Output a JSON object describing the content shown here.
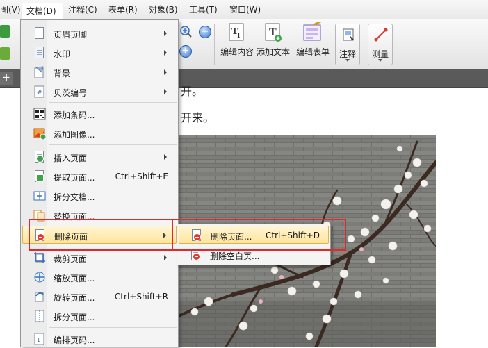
{
  "menubar": {
    "items": [
      {
        "label": "图(V)"
      },
      {
        "label": "文档(D)"
      },
      {
        "label": "注释(C)"
      },
      {
        "label": "表单(R)"
      },
      {
        "label": "对象(B)"
      },
      {
        "label": "工具(T)"
      },
      {
        "label": "窗口(W)"
      }
    ]
  },
  "toolbar": {
    "edit_content": "编辑内容",
    "add_text": "添加文本",
    "edit_form": "编辑表单",
    "annotate": "注释",
    "measure": "测量"
  },
  "tabstrip": {
    "plus": "+"
  },
  "document": {
    "line1": "开。",
    "line2": "开来。"
  },
  "document_menu": {
    "items": [
      {
        "label": "页眉页脚",
        "shortcut": ""
      },
      {
        "label": "水印",
        "shortcut": ""
      },
      {
        "label": "背景",
        "shortcut": ""
      },
      {
        "label": "贝茨编号",
        "shortcut": ""
      },
      {
        "label": "添加条码...",
        "shortcut": ""
      },
      {
        "label": "添加图像...",
        "shortcut": ""
      },
      {
        "label": "插入页面",
        "shortcut": ""
      },
      {
        "label": "提取页面...",
        "shortcut": "Ctrl+Shift+E"
      },
      {
        "label": "拆分文档...",
        "shortcut": ""
      },
      {
        "label": "替换页面...",
        "shortcut": ""
      },
      {
        "label": "删除页面",
        "shortcut": ""
      },
      {
        "label": "裁剪页面",
        "shortcut": ""
      },
      {
        "label": "缩放页面...",
        "shortcut": ""
      },
      {
        "label": "旋转页面...",
        "shortcut": "Ctrl+Shift+R"
      },
      {
        "label": "拆分页面...",
        "shortcut": ""
      },
      {
        "label": "编排页码...",
        "shortcut": ""
      }
    ]
  },
  "delete_submenu": {
    "items": [
      {
        "label": "删除页面...",
        "shortcut": "Ctrl+Shift+D"
      },
      {
        "label": "删除空白页...",
        "shortcut": ""
      }
    ]
  },
  "colors": {
    "highlight_border": "#e02a2a",
    "menu_hover": "#ffe49a"
  }
}
